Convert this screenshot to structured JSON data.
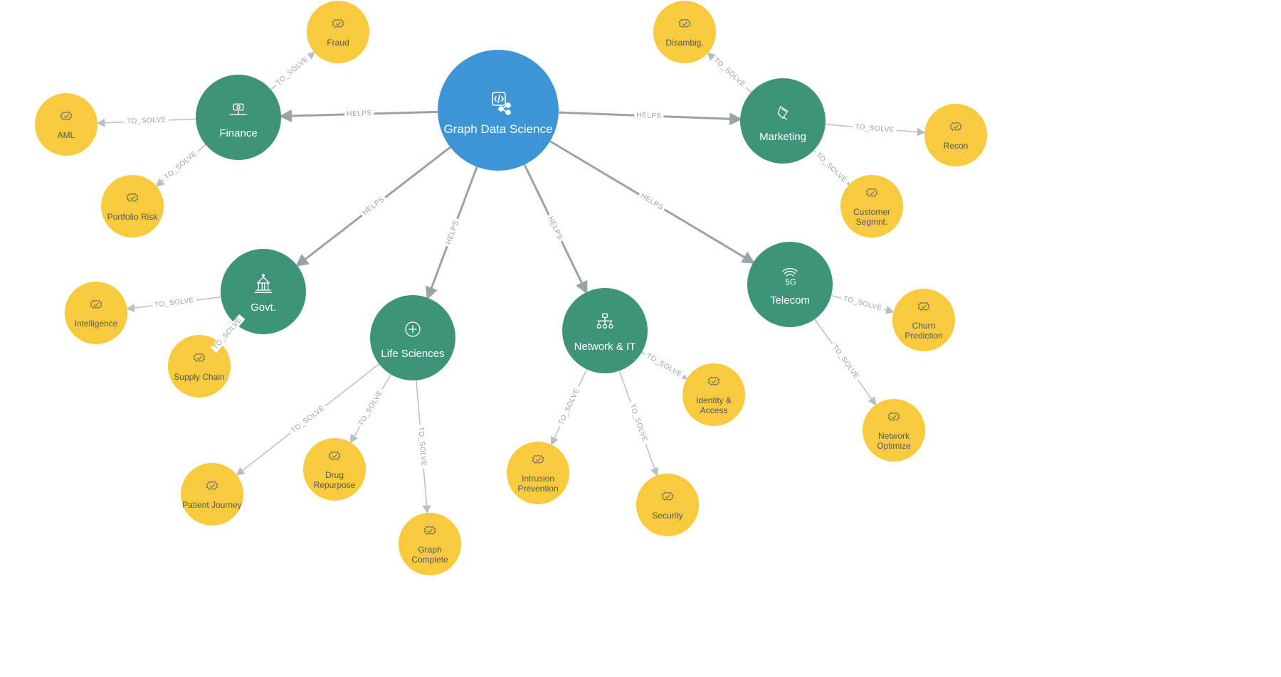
{
  "colors": {
    "root": "#3d95d6",
    "sector": "#3d9479",
    "leaf": "#f9ca3e",
    "edge": "#9aa3a8",
    "text": "#4e5a60"
  },
  "labels": {
    "helps": "HELPS",
    "to_solve": "TO_SOLVE"
  },
  "root": {
    "label": "Graph Data Science"
  },
  "sectors": {
    "finance": {
      "label": "Finance"
    },
    "govt": {
      "label": "Govt."
    },
    "life": {
      "label": "Life Sciences"
    },
    "net": {
      "label": "Network & IT"
    },
    "telecom": {
      "label": "Telecom"
    },
    "marketing": {
      "label": "Marketing"
    }
  },
  "leaves": {
    "fraud": {
      "label": "Fraud"
    },
    "aml": {
      "label": "AML"
    },
    "portfolio": {
      "label": "Portfolio Risk"
    },
    "intel": {
      "label": "Intelligence"
    },
    "supply": {
      "label": "Supply Chain"
    },
    "patient": {
      "label": "Patient Journey"
    },
    "drug": {
      "label": "Drug Repurpose"
    },
    "graphcomp": {
      "label": "Graph Complete"
    },
    "intrusion": {
      "label": "Intrusion Prevention"
    },
    "security": {
      "label": "Security"
    },
    "identity": {
      "label": "Identity & Access"
    },
    "churn": {
      "label": "Churn Prediction"
    },
    "netopt": {
      "label": "Network Optimize"
    },
    "disambig": {
      "label": "Disambig."
    },
    "recon": {
      "label": "Recon"
    },
    "custseg": {
      "label": "Customer Segmnt."
    }
  }
}
